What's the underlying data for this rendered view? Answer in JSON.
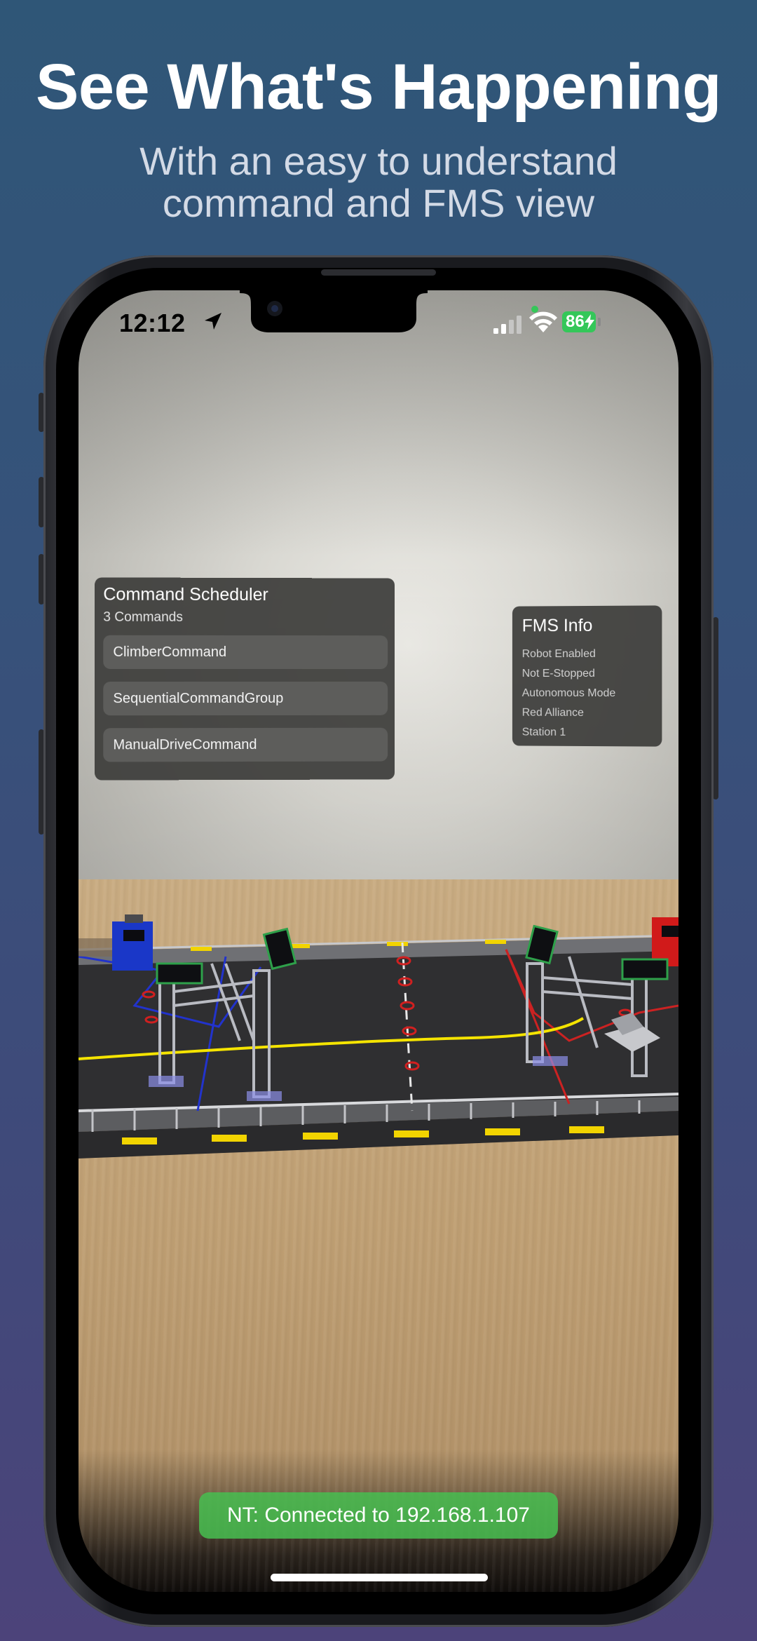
{
  "promo": {
    "headline": "See What's Happening",
    "subline_1": "With an easy to understand",
    "subline_2": "command and FMS view"
  },
  "status_bar": {
    "time": "12:12",
    "battery": "86",
    "icons": [
      "location-arrow-icon",
      "cellular-signal-icon",
      "wifi-icon",
      "battery-icon",
      "charging-bolt-icon"
    ],
    "battery_color": "#34c759"
  },
  "command_scheduler": {
    "title": "Command Scheduler",
    "count": "3 Commands",
    "commands": [
      {
        "label": "ClimberCommand"
      },
      {
        "label": "SequentialCommandGroup"
      },
      {
        "label": "ManualDriveCommand"
      }
    ]
  },
  "fms_info": {
    "title": "FMS Info",
    "lines": [
      "Robot Enabled",
      "Not E-Stopped",
      "Autonomous Mode",
      "Red Alliance",
      "Station 1"
    ]
  },
  "network": {
    "status": "NT: Connected to 192.168.1.107",
    "color": "#46be50"
  },
  "colors": {
    "background_top": "#2f5677",
    "background_bottom": "#4c437a",
    "blue_alliance": "#1a37c8",
    "red_alliance": "#d11a1a",
    "field_line_yellow": "#f5e400"
  }
}
